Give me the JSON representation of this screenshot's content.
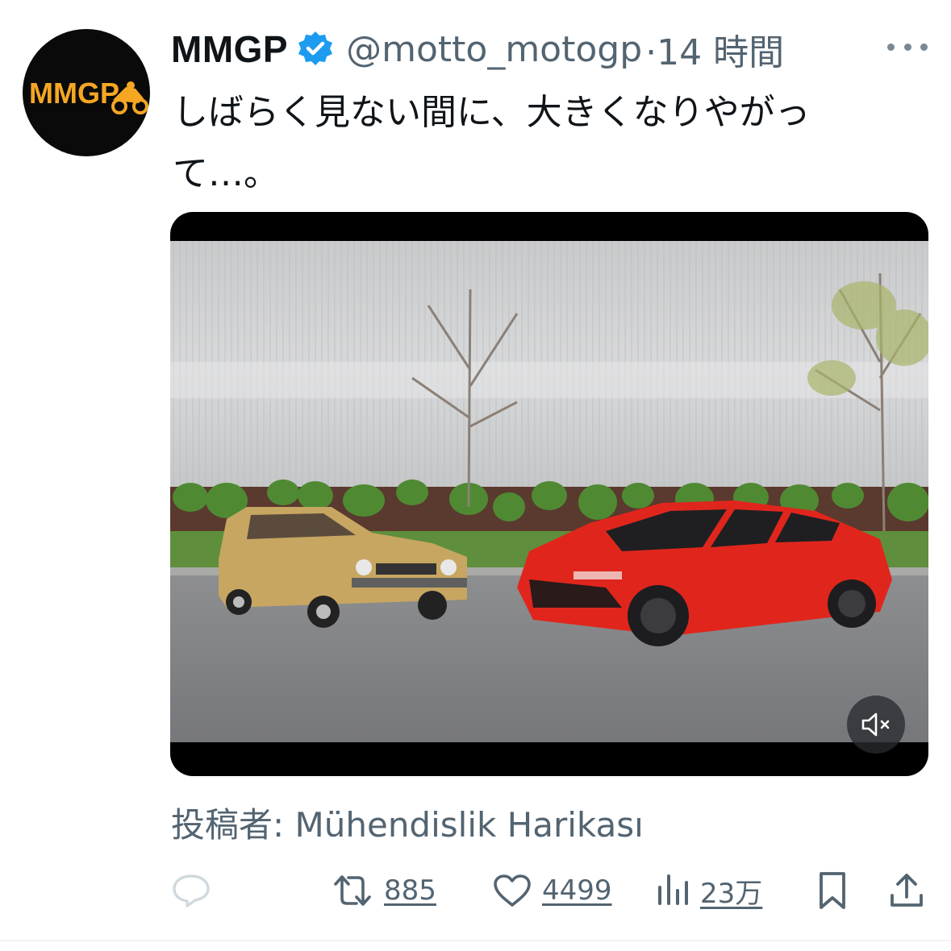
{
  "author": {
    "display_name": "MMGP",
    "handle": "@motto_motogp",
    "time": "·14 時間",
    "avatar_logo_text": "MMGP",
    "verified": true
  },
  "tweet": {
    "text": "しばらく見ない間に、大きくなりやがって…。"
  },
  "media": {
    "type": "video",
    "muted": true
  },
  "attribution": "投稿者: Mühendislik Harikası",
  "actions": {
    "reply_count": "",
    "retweet_count": "885",
    "like_count": "4499",
    "views_count": "23万"
  },
  "colors": {
    "text": "#0f1419",
    "secondary": "#536471",
    "verified": "#1d9bf0",
    "logo": "#f5a623"
  }
}
